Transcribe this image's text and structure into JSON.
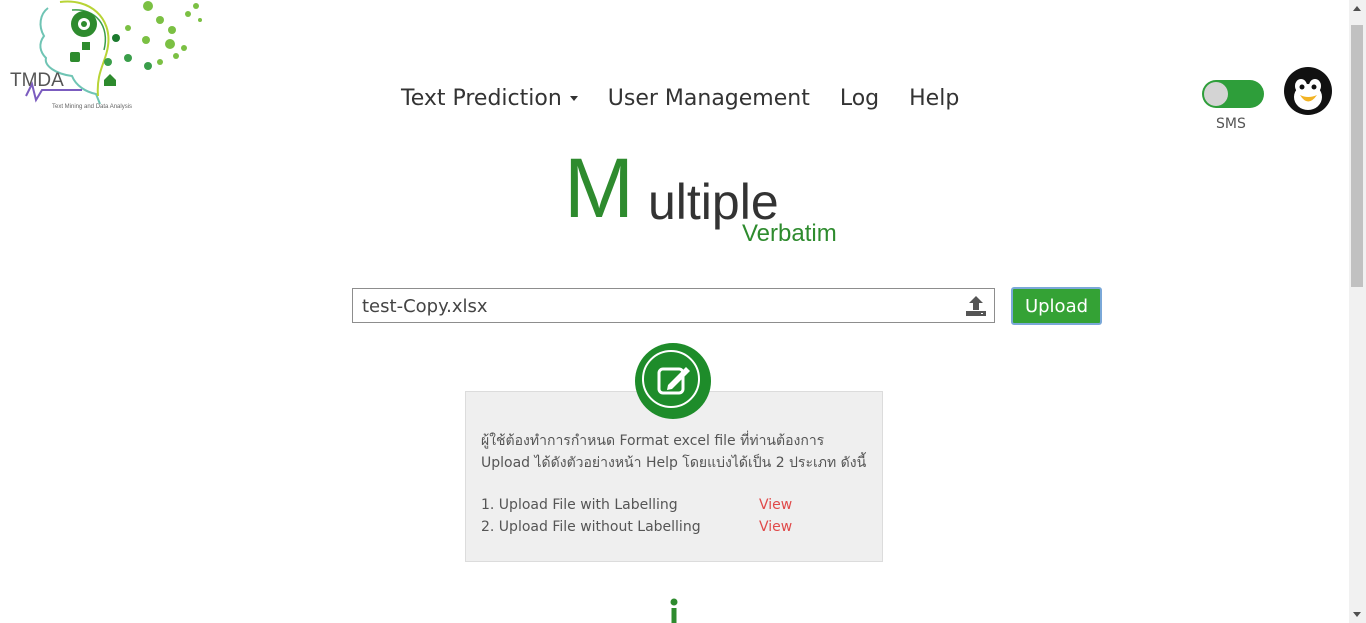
{
  "logo": {
    "text": "TMDA",
    "subtitle": "Text Mining and Data Analysis"
  },
  "nav": {
    "text_prediction": "Text Prediction",
    "user_management": "User Management",
    "log": "Log",
    "help": "Help"
  },
  "sms": {
    "label": "SMS",
    "enabled": true
  },
  "brand": {
    "first_letter": "M",
    "rest": "ultiple",
    "sub": "Verbatim"
  },
  "upload": {
    "file_name": "test-Copy.xlsx",
    "button_label": "Upload"
  },
  "info": {
    "description": "ผู้ใช้ต้องทำการกำหนด Format excel file ที่ท่านต้องการ Upload ได้ดังตัวอย่างหน้า Help โดยแบ่งได้เป็น 2 ประเภท ดังนี้",
    "items": [
      {
        "label": "1. Upload File with Labelling",
        "link": "View"
      },
      {
        "label": "2. Upload File without Labelling",
        "link": "View"
      }
    ]
  },
  "colors": {
    "brand_green": "#2e8b2e",
    "button_green": "#34a235",
    "link_red": "#e04a4a"
  }
}
